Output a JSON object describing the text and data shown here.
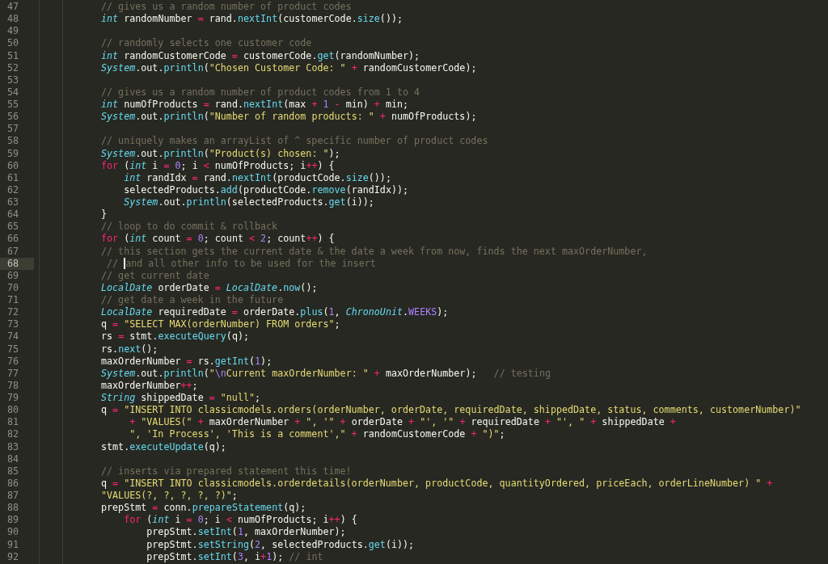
{
  "lines": [
    {
      "number": "47",
      "active": false,
      "tokens": [
        {
          "kind": "comment",
          "text": "// gives us a random number of product codes"
        }
      ]
    },
    {
      "number": "48",
      "active": false,
      "tokens": [
        {
          "kind": "type",
          "text": "int"
        },
        {
          "kind": "plain",
          "text": " randomNumber "
        },
        {
          "kind": "op",
          "text": "="
        },
        {
          "kind": "plain",
          "text": " rand."
        },
        {
          "kind": "func",
          "text": "nextInt"
        },
        {
          "kind": "plain",
          "text": "(customerCode."
        },
        {
          "kind": "func",
          "text": "size"
        },
        {
          "kind": "plain",
          "text": "());"
        }
      ]
    },
    {
      "number": "49",
      "active": false
    },
    {
      "number": "50",
      "active": false,
      "tokens": [
        {
          "kind": "comment",
          "text": "// randomly selects one customer code"
        }
      ]
    },
    {
      "number": "51",
      "active": false,
      "tokens": [
        {
          "kind": "type",
          "text": "int"
        },
        {
          "kind": "plain",
          "text": " randomCustomerCode "
        },
        {
          "kind": "op",
          "text": "="
        },
        {
          "kind": "plain",
          "text": " customerCode."
        },
        {
          "kind": "func",
          "text": "get"
        },
        {
          "kind": "plain",
          "text": "(randomNumber);"
        }
      ]
    },
    {
      "number": "52",
      "active": false,
      "tokens": [
        {
          "kind": "type",
          "text": "System"
        },
        {
          "kind": "plain",
          "text": ".out."
        },
        {
          "kind": "func",
          "text": "println"
        },
        {
          "kind": "plain",
          "text": "("
        },
        {
          "kind": "string",
          "text": "\"Chosen Customer Code: \" "
        },
        {
          "kind": "op",
          "text": "+"
        },
        {
          "kind": "plain",
          "text": " randomCustomerCode);"
        }
      ]
    },
    {
      "number": "53",
      "active": false
    },
    {
      "number": "54",
      "active": false,
      "tokens": [
        {
          "kind": "comment",
          "text": "// gives us a random number of product codes from 1 to 4"
        }
      ]
    },
    {
      "number": "55",
      "active": false,
      "tokens": [
        {
          "kind": "type",
          "text": "int"
        },
        {
          "kind": "plain",
          "text": " numOfProducts "
        },
        {
          "kind": "op",
          "text": "="
        },
        {
          "kind": "plain",
          "text": " rand."
        },
        {
          "kind": "func",
          "text": "nextInt"
        },
        {
          "kind": "plain",
          "text": "(max "
        },
        {
          "kind": "op",
          "text": "+ "
        },
        {
          "kind": "number",
          "text": "1 "
        },
        {
          "kind": "op",
          "text": "-"
        },
        {
          "kind": "plain",
          "text": " min) "
        },
        {
          "kind": "op",
          "text": "+"
        },
        {
          "kind": "plain",
          "text": " min;"
        }
      ]
    },
    {
      "number": "56",
      "active": false,
      "tokens": [
        {
          "kind": "type",
          "text": "System"
        },
        {
          "kind": "plain",
          "text": ".out."
        },
        {
          "kind": "func",
          "text": "println"
        },
        {
          "kind": "plain",
          "text": "("
        },
        {
          "kind": "string",
          "text": "\"Number of random products: \" "
        },
        {
          "kind": "op",
          "text": "+"
        },
        {
          "kind": "plain",
          "text": " numOfProducts);"
        }
      ]
    },
    {
      "number": "57",
      "active": false
    },
    {
      "number": "58",
      "active": false,
      "tokens": [
        {
          "kind": "comment",
          "text": "// uniquely makes an arrayList of ^ specific number of product codes"
        }
      ]
    },
    {
      "number": "59",
      "active": false,
      "tokens": [
        {
          "kind": "type",
          "text": "System"
        },
        {
          "kind": "plain",
          "text": ".out."
        },
        {
          "kind": "func",
          "text": "println"
        },
        {
          "kind": "plain",
          "text": "("
        },
        {
          "kind": "string",
          "text": "\"Product(s) chosen: \""
        },
        {
          "kind": "plain",
          "text": ");"
        }
      ]
    },
    {
      "number": "60",
      "active": false,
      "tokens": [
        {
          "kind": "keyword",
          "text": "for"
        },
        {
          "kind": "plain",
          "text": " ("
        },
        {
          "kind": "type",
          "text": "int"
        },
        {
          "kind": "plain",
          "text": " i "
        },
        {
          "kind": "op",
          "text": "= "
        },
        {
          "kind": "number",
          "text": "0"
        },
        {
          "kind": "plain",
          "text": "; i "
        },
        {
          "kind": "op",
          "text": "<"
        },
        {
          "kind": "plain",
          "text": " numOfProducts; i"
        },
        {
          "kind": "op",
          "text": "++"
        },
        {
          "kind": "plain",
          "text": ") {"
        }
      ]
    },
    {
      "number": "61",
      "active": false,
      "tokens": [
        {
          "kind": "type",
          "text": "    int"
        },
        {
          "kind": "plain",
          "text": " randIdx "
        },
        {
          "kind": "op",
          "text": "="
        },
        {
          "kind": "plain",
          "text": " rand."
        },
        {
          "kind": "func",
          "text": "nextInt"
        },
        {
          "kind": "plain",
          "text": "(productCode."
        },
        {
          "kind": "func",
          "text": "size"
        },
        {
          "kind": "plain",
          "text": "());"
        }
      ]
    },
    {
      "number": "62",
      "active": false,
      "tokens": [
        {
          "kind": "plain",
          "text": "    selectedProducts."
        },
        {
          "kind": "func",
          "text": "add"
        },
        {
          "kind": "plain",
          "text": "(productCode."
        },
        {
          "kind": "func",
          "text": "remove"
        },
        {
          "kind": "plain",
          "text": "(randIdx));"
        }
      ]
    },
    {
      "number": "63",
      "active": false,
      "tokens": [
        {
          "kind": "type",
          "text": "    System"
        },
        {
          "kind": "plain",
          "text": ".out."
        },
        {
          "kind": "func",
          "text": "println"
        },
        {
          "kind": "plain",
          "text": "(selectedProducts."
        },
        {
          "kind": "func",
          "text": "get"
        },
        {
          "kind": "plain",
          "text": "(i));"
        }
      ]
    },
    {
      "number": "64",
      "active": false,
      "tokens": [
        {
          "kind": "plain",
          "text": "}"
        }
      ]
    },
    {
      "number": "65",
      "active": false,
      "tokens": [
        {
          "kind": "comment",
          "text": "// loop to do commit & rollback"
        }
      ]
    },
    {
      "number": "66",
      "active": false,
      "tokens": [
        {
          "kind": "keyword",
          "text": "for"
        },
        {
          "kind": "plain",
          "text": " ("
        },
        {
          "kind": "type",
          "text": "int"
        },
        {
          "kind": "plain",
          "text": " count "
        },
        {
          "kind": "op",
          "text": "= "
        },
        {
          "kind": "number",
          "text": "0"
        },
        {
          "kind": "plain",
          "text": "; count "
        },
        {
          "kind": "op",
          "text": "< "
        },
        {
          "kind": "number",
          "text": "2"
        },
        {
          "kind": "plain",
          "text": "; count"
        },
        {
          "kind": "op",
          "text": "++"
        },
        {
          "kind": "plain",
          "text": ") {"
        }
      ]
    },
    {
      "number": "67",
      "active": false,
      "tokens": [
        {
          "kind": "comment",
          "text": "// this section gets the current date & the date a week from now, finds the next maxOrderNumber,"
        }
      ]
    },
    {
      "number": "68",
      "active": true,
      "tokens": [
        {
          "kind": "comment",
          "text": " // "
        },
        {
          "kind": "cursor"
        },
        {
          "kind": "comment",
          "text": "and all other info to be used for the insert"
        }
      ]
    },
    {
      "number": "69",
      "active": false,
      "tokens": [
        {
          "kind": "comment",
          "text": "// get current date"
        }
      ]
    },
    {
      "number": "70",
      "active": false,
      "tokens": [
        {
          "kind": "type",
          "text": "LocalDate"
        },
        {
          "kind": "plain",
          "text": " orderDate "
        },
        {
          "kind": "op",
          "text": "= "
        },
        {
          "kind": "type",
          "text": "LocalDate"
        },
        {
          "kind": "plain",
          "text": "."
        },
        {
          "kind": "func",
          "text": "now"
        },
        {
          "kind": "plain",
          "text": "();"
        }
      ]
    },
    {
      "number": "71",
      "active": false,
      "tokens": [
        {
          "kind": "comment",
          "text": "// get date a week in the future"
        }
      ]
    },
    {
      "number": "72",
      "active": false,
      "tokens": [
        {
          "kind": "type",
          "text": "LocalDate"
        },
        {
          "kind": "plain",
          "text": " requiredDate "
        },
        {
          "kind": "op",
          "text": "="
        },
        {
          "kind": "plain",
          "text": " orderDate."
        },
        {
          "kind": "func",
          "text": "plus"
        },
        {
          "kind": "plain",
          "text": "("
        },
        {
          "kind": "number",
          "text": "1"
        },
        {
          "kind": "plain",
          "text": ", "
        },
        {
          "kind": "type",
          "text": "ChronoUnit"
        },
        {
          "kind": "plain",
          "text": "."
        },
        {
          "kind": "number",
          "text": "WEEKS"
        },
        {
          "kind": "plain",
          "text": ");"
        }
      ]
    },
    {
      "number": "73",
      "active": false,
      "tokens": [
        {
          "kind": "plain",
          "text": "q "
        },
        {
          "kind": "op",
          "text": "= "
        },
        {
          "kind": "string",
          "text": "\"SELECT MAX(orderNumber) FROM orders\""
        },
        {
          "kind": "plain",
          "text": ";"
        }
      ]
    },
    {
      "number": "74",
      "active": false,
      "tokens": [
        {
          "kind": "plain",
          "text": "rs "
        },
        {
          "kind": "op",
          "text": "="
        },
        {
          "kind": "plain",
          "text": " stmt."
        },
        {
          "kind": "func",
          "text": "executeQuery"
        },
        {
          "kind": "plain",
          "text": "(q);"
        }
      ]
    },
    {
      "number": "75",
      "active": false,
      "tokens": [
        {
          "kind": "plain",
          "text": "rs."
        },
        {
          "kind": "func",
          "text": "next"
        },
        {
          "kind": "plain",
          "text": "();"
        }
      ]
    },
    {
      "number": "76",
      "active": false,
      "tokens": [
        {
          "kind": "plain",
          "text": "maxOrderNumber "
        },
        {
          "kind": "op",
          "text": "="
        },
        {
          "kind": "plain",
          "text": " rs."
        },
        {
          "kind": "func",
          "text": "getInt"
        },
        {
          "kind": "plain",
          "text": "("
        },
        {
          "kind": "number",
          "text": "1"
        },
        {
          "kind": "plain",
          "text": ");"
        }
      ]
    },
    {
      "number": "77",
      "active": false,
      "tokens": [
        {
          "kind": "type",
          "text": "System"
        },
        {
          "kind": "plain",
          "text": ".out."
        },
        {
          "kind": "func",
          "text": "println"
        },
        {
          "kind": "plain",
          "text": "("
        },
        {
          "kind": "string",
          "text": "\""
        },
        {
          "kind": "number",
          "text": "\\n"
        },
        {
          "kind": "string",
          "text": "Current maxOrderNumber: \" "
        },
        {
          "kind": "op",
          "text": "+"
        },
        {
          "kind": "plain",
          "text": " maxOrderNumber);   "
        },
        {
          "kind": "comment",
          "text": "// testing"
        }
      ]
    },
    {
      "number": "78",
      "active": false,
      "tokens": [
        {
          "kind": "plain",
          "text": "maxOrderNumber"
        },
        {
          "kind": "op",
          "text": "++"
        },
        {
          "kind": "plain",
          "text": ";"
        }
      ]
    },
    {
      "number": "79",
      "active": false,
      "tokens": [
        {
          "kind": "type",
          "text": "String"
        },
        {
          "kind": "plain",
          "text": " shippedDate "
        },
        {
          "kind": "op",
          "text": "= "
        },
        {
          "kind": "string",
          "text": "\"null\""
        },
        {
          "kind": "plain",
          "text": ";"
        }
      ]
    },
    {
      "number": "80",
      "active": false,
      "tokens": [
        {
          "kind": "plain",
          "text": "q "
        },
        {
          "kind": "op",
          "text": "= "
        },
        {
          "kind": "string",
          "text": "\"INSERT INTO classicmodels.orders(orderNumber, orderDate, requiredDate, shippedDate, status, comments, customerNumber)\""
        }
      ]
    },
    {
      "number": "81",
      "active": false,
      "tokens": [
        {
          "kind": "op",
          "text": "     + "
        },
        {
          "kind": "string",
          "text": "\"VALUES(\" "
        },
        {
          "kind": "op",
          "text": "+"
        },
        {
          "kind": "plain",
          "text": " maxOrderNumber "
        },
        {
          "kind": "op",
          "text": "+ "
        },
        {
          "kind": "string",
          "text": "\", '\" "
        },
        {
          "kind": "op",
          "text": "+"
        },
        {
          "kind": "plain",
          "text": " orderDate "
        },
        {
          "kind": "op",
          "text": "+ "
        },
        {
          "kind": "string",
          "text": "\"', '\" "
        },
        {
          "kind": "op",
          "text": "+"
        },
        {
          "kind": "plain",
          "text": " requiredDate "
        },
        {
          "kind": "op",
          "text": "+ "
        },
        {
          "kind": "string",
          "text": "\"', \" "
        },
        {
          "kind": "op",
          "text": "+"
        },
        {
          "kind": "plain",
          "text": " shippedDate "
        },
        {
          "kind": "op",
          "text": "+"
        }
      ]
    },
    {
      "number": "82",
      "active": false,
      "tokens": [
        {
          "kind": "string",
          "text": "     \", 'In Process', 'This is a comment',\" "
        },
        {
          "kind": "op",
          "text": "+"
        },
        {
          "kind": "plain",
          "text": " randomCustomerCode "
        },
        {
          "kind": "op",
          "text": "+ "
        },
        {
          "kind": "string",
          "text": "\")\""
        },
        {
          "kind": "plain",
          "text": ";"
        }
      ]
    },
    {
      "number": "83",
      "active": false,
      "tokens": [
        {
          "kind": "plain",
          "text": "stmt."
        },
        {
          "kind": "func",
          "text": "executeUpdate"
        },
        {
          "kind": "plain",
          "text": "(q);"
        }
      ]
    },
    {
      "number": "84",
      "active": false
    },
    {
      "number": "85",
      "active": false,
      "tokens": [
        {
          "kind": "comment",
          "text": "// inserts via prepared statement this time!"
        }
      ]
    },
    {
      "number": "86",
      "active": false,
      "tokens": [
        {
          "kind": "plain",
          "text": "q "
        },
        {
          "kind": "op",
          "text": "= "
        },
        {
          "kind": "string",
          "text": "\"INSERT INTO classicmodels.orderdetails(orderNumber, productCode, quantityOrdered, priceEach, orderLineNumber) \" "
        },
        {
          "kind": "op",
          "text": "+"
        }
      ]
    },
    {
      "number": "87",
      "active": false,
      "tokens": [
        {
          "kind": "string",
          "text": "\"VALUES(?, ?, ?, ?, ?)\""
        },
        {
          "kind": "plain",
          "text": ";"
        }
      ]
    },
    {
      "number": "88",
      "active": false,
      "tokens": [
        {
          "kind": "plain",
          "text": "prepStmt "
        },
        {
          "kind": "op",
          "text": "="
        },
        {
          "kind": "plain",
          "text": " conn."
        },
        {
          "kind": "func",
          "text": "prepareStatement"
        },
        {
          "kind": "plain",
          "text": "(q);"
        }
      ]
    },
    {
      "number": "89",
      "active": false,
      "tokens": [
        {
          "kind": "keyword",
          "text": "    for"
        },
        {
          "kind": "plain",
          "text": " ("
        },
        {
          "kind": "type",
          "text": "int"
        },
        {
          "kind": "plain",
          "text": " i "
        },
        {
          "kind": "op",
          "text": "= "
        },
        {
          "kind": "number",
          "text": "0"
        },
        {
          "kind": "plain",
          "text": "; i "
        },
        {
          "kind": "op",
          "text": "<"
        },
        {
          "kind": "plain",
          "text": " numOfProducts; i"
        },
        {
          "kind": "op",
          "text": "++"
        },
        {
          "kind": "plain",
          "text": ") {"
        }
      ]
    },
    {
      "number": "90",
      "active": false,
      "tokens": [
        {
          "kind": "plain",
          "text": "        prepStmt."
        },
        {
          "kind": "func",
          "text": "setInt"
        },
        {
          "kind": "plain",
          "text": "("
        },
        {
          "kind": "number",
          "text": "1"
        },
        {
          "kind": "plain",
          "text": ", maxOrderNumber);"
        }
      ]
    },
    {
      "number": "91",
      "active": false,
      "tokens": [
        {
          "kind": "plain",
          "text": "        prepStmt."
        },
        {
          "kind": "func",
          "text": "setString"
        },
        {
          "kind": "plain",
          "text": "("
        },
        {
          "kind": "number",
          "text": "2"
        },
        {
          "kind": "plain",
          "text": ", selectedProducts."
        },
        {
          "kind": "func",
          "text": "get"
        },
        {
          "kind": "plain",
          "text": "(i));"
        }
      ]
    },
    {
      "number": "92",
      "active": false,
      "tokens": [
        {
          "kind": "plain",
          "text": "        prepStmt."
        },
        {
          "kind": "func",
          "text": "setInt"
        },
        {
          "kind": "plain",
          "text": "("
        },
        {
          "kind": "number",
          "text": "3"
        },
        {
          "kind": "plain",
          "text": ", i"
        },
        {
          "kind": "op",
          "text": "+"
        },
        {
          "kind": "number",
          "text": "1"
        },
        {
          "kind": "plain",
          "text": "); "
        },
        {
          "kind": "comment",
          "text": "// int"
        }
      ]
    }
  ]
}
